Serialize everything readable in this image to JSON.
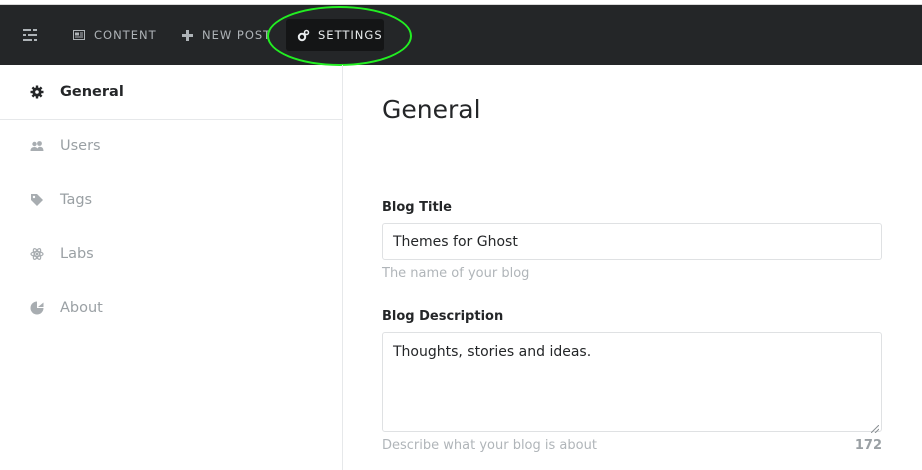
{
  "topnav": {
    "content_label": "CONTENT",
    "new_post_label": "NEW POST",
    "settings_label": "SETTINGS"
  },
  "sidebar": {
    "items": [
      {
        "label": "General",
        "icon": "gear-icon",
        "active": true
      },
      {
        "label": "Users",
        "icon": "users-icon",
        "active": false
      },
      {
        "label": "Tags",
        "icon": "tag-icon",
        "active": false
      },
      {
        "label": "Labs",
        "icon": "atom-icon",
        "active": false
      },
      {
        "label": "About",
        "icon": "ghost-icon",
        "active": false
      }
    ]
  },
  "main": {
    "title": "General",
    "blog_title": {
      "label": "Blog Title",
      "value": "Themes for Ghost",
      "help": "The name of your blog"
    },
    "blog_description": {
      "label": "Blog Description",
      "value": "Thoughts, stories and ideas.",
      "help": "Describe what your blog is about",
      "counter": "172"
    }
  },
  "colors": {
    "topbar_bg": "#242628",
    "highlight": "#22ee22",
    "active_text": "#242628",
    "muted_text": "#9aa0a4"
  }
}
